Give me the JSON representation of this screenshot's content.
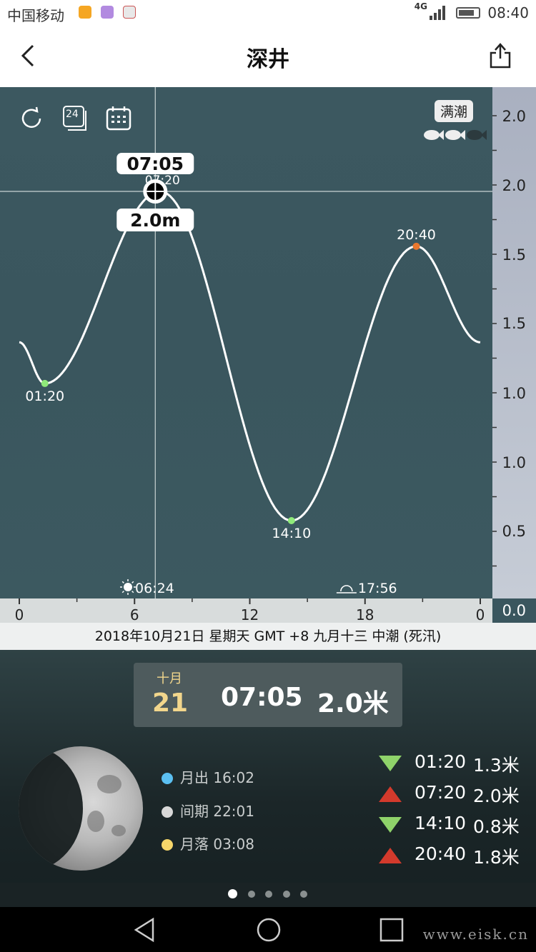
{
  "status_bar": {
    "carrier": "中国移动",
    "network": "4G",
    "time": "08:40",
    "app_icons": [
      "notification-app-icon",
      "gallery-icon",
      "app-icon"
    ]
  },
  "nav": {
    "title": "深井",
    "back_icon": "back-arrow-icon",
    "share_icon": "share-icon"
  },
  "toolbar": {
    "refresh_icon": "refresh-icon",
    "day24_label": "24",
    "calendar_icon": "calendar-icon",
    "spring_tide_badge": "满潮",
    "fish_icon": "fish-rating-icon",
    "fish_rating": 2,
    "fish_max": 3
  },
  "chart_data": {
    "type": "line",
    "x_ticks": [
      "0",
      "6",
      "12",
      "18",
      "0"
    ],
    "xlim": [
      0,
      24
    ],
    "y_tick_labels": [
      "2.0",
      "2.0",
      "1.5",
      "1.5",
      "1.0",
      "1.0",
      "0.5",
      "0.0"
    ],
    "extremes": [
      {
        "label": "01:20",
        "x": 1.33,
        "y": 1.3,
        "kind": "low",
        "color": "#8fea7a"
      },
      {
        "label": "07:20",
        "x": 7.33,
        "y": 2.0,
        "kind": "high",
        "color": "#ffffff"
      },
      {
        "label": "14:10",
        "x": 14.17,
        "y": 0.8,
        "kind": "low",
        "color": "#8fea7a"
      },
      {
        "label": "20:40",
        "x": 20.67,
        "y": 1.8,
        "kind": "high",
        "color": "#e8772e"
      }
    ],
    "curve_start": {
      "x": 0,
      "y": 1.45
    },
    "curve_end": {
      "x": 24,
      "y": 1.45
    },
    "cursor": {
      "time": "07:05",
      "height": "2.0m",
      "x": 7.08
    },
    "sunrise": "06:24",
    "sunset": "17:56",
    "sunrise_x": 6.4,
    "sunset_x": 17.93
  },
  "date_bar": "2018年10月21日  星期天  GMT +8  九月十三  中潮 (死汛)",
  "current": {
    "month": "十月",
    "day": "21",
    "time": "07:05",
    "height": "2.0米"
  },
  "moon": {
    "rows": [
      {
        "label": "月出 16:02",
        "color": "#5bc0f2"
      },
      {
        "label": "间期 22:01",
        "color": "#d8d8d8"
      },
      {
        "label": "月落 03:08",
        "color": "#f6d66a"
      }
    ]
  },
  "tides": [
    {
      "time": "01:20",
      "height": "1.3米",
      "dir": "down",
      "color": "#8fd36a"
    },
    {
      "time": "07:20",
      "height": "2.0米",
      "dir": "up",
      "color": "#d33a2c"
    },
    {
      "time": "14:10",
      "height": "0.8米",
      "dir": "down",
      "color": "#8fd36a"
    },
    {
      "time": "20:40",
      "height": "1.8米",
      "dir": "up",
      "color": "#d33a2c"
    }
  ],
  "pager": {
    "count": 5,
    "active": 0
  },
  "system_nav": [
    "back-icon",
    "home-icon",
    "recents-icon"
  ],
  "watermark": "www.eisk.cn"
}
